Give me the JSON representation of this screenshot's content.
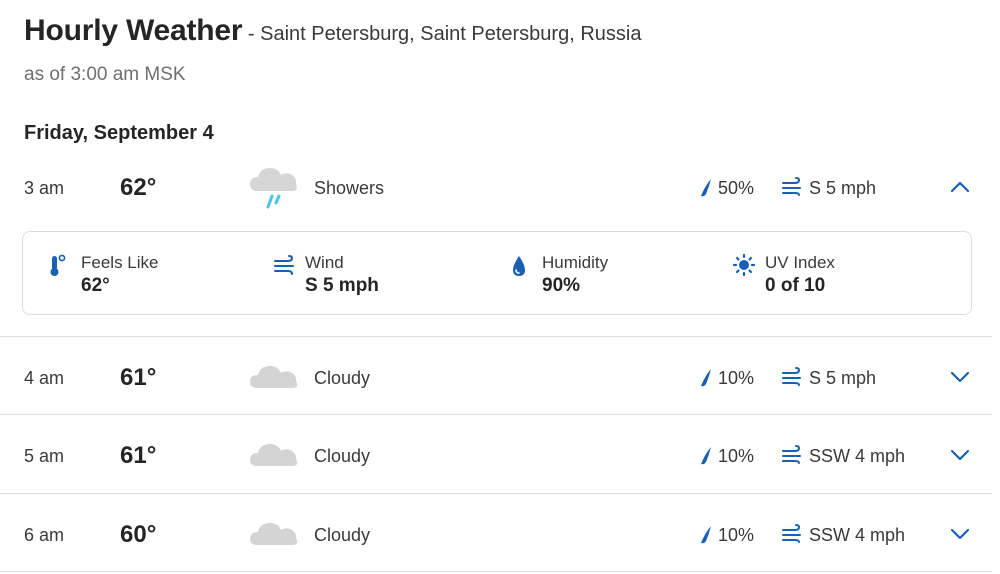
{
  "header": {
    "title": "Hourly Weather",
    "location": " - Saint Petersburg, Saint Petersburg, Russia",
    "as_of": "as of 3:00 am MSK"
  },
  "day_label": "Friday, September 4",
  "colors": {
    "accent": "#1a5fb4",
    "text": "#252525",
    "muted": "#6f6f6f",
    "cloud": "#d4d4d4",
    "rain": "#4dc3e6"
  },
  "hours": [
    {
      "time": "3 am",
      "temp": "62°",
      "icon": "showers-icon",
      "condition": "Showers",
      "precip": "50%",
      "wind": "S 5 mph",
      "expanded": true
    },
    {
      "time": "4 am",
      "temp": "61°",
      "icon": "cloudy-icon",
      "condition": "Cloudy",
      "precip": "10%",
      "wind": "S 5 mph",
      "expanded": false
    },
    {
      "time": "5 am",
      "temp": "61°",
      "icon": "cloudy-icon",
      "condition": "Cloudy",
      "precip": "10%",
      "wind": "SSW 4 mph",
      "expanded": false
    },
    {
      "time": "6 am",
      "temp": "60°",
      "icon": "cloudy-icon",
      "condition": "Cloudy",
      "precip": "10%",
      "wind": "SSW 4 mph",
      "expanded": false
    }
  ],
  "details": [
    {
      "icon": "thermometer-icon",
      "label": "Feels Like",
      "value": "62°"
    },
    {
      "icon": "wind-icon",
      "label": "Wind",
      "value": "S 5 mph"
    },
    {
      "icon": "humidity-drop-icon",
      "label": "Humidity",
      "value": "90%"
    },
    {
      "icon": "uv-sun-icon",
      "label": "UV Index",
      "value": "0 of 10"
    }
  ]
}
